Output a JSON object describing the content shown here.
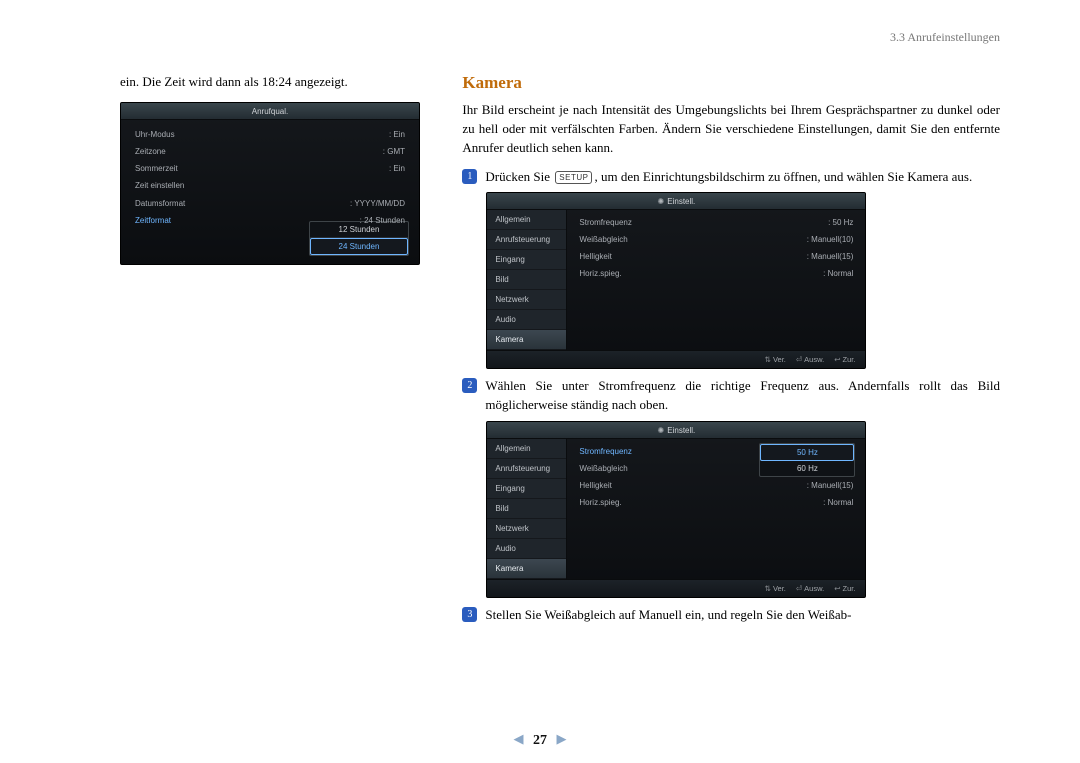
{
  "header": {
    "section_label": "3.3 Anrufeinstellungen"
  },
  "left": {
    "intro": "ein. Die Zeit wird dann als 18:24 angezeigt.",
    "shot1": {
      "title": "Anrufqual.",
      "rows": [
        {
          "k": "Uhr-Modus",
          "v": ": Ein"
        },
        {
          "k": "Zeitzone",
          "v": ": GMT"
        },
        {
          "k": "Sommerzeit",
          "v": ": Ein"
        },
        {
          "k": "Zeit einstellen",
          "v": ""
        },
        {
          "k": "Datumsformat",
          "v": ": YYYY/MM/DD"
        }
      ],
      "active_row": {
        "k": "Zeitformat",
        "v": ": 24 Stunden"
      },
      "options": [
        {
          "label": "12 Stunden",
          "sel": false
        },
        {
          "label": "24 Stunden",
          "sel": true
        }
      ]
    }
  },
  "right": {
    "title": "Kamera",
    "intro": "Ihr Bild erscheint je nach Intensität des Umgebungslichts bei Ihrem Gesprächspartner zu dunkel oder zu hell oder mit verfälschten Farben. Ändern Sie verschiedene Einstellungen, damit Sie den entfernte Anrufer deutlich sehen kann.",
    "steps": {
      "s1a": "Drücken Sie ",
      "s1_key": "SETUP",
      "s1b": ", um den Einrichtungsbildschirm zu öffnen, und wählen Sie Kamera aus.",
      "s2": "Wählen Sie unter Stromfrequenz die richtige Frequenz aus. Andernfalls rollt das Bild möglicherweise ständig nach oben.",
      "s3": "Stellen Sie Weißabgleich auf Manuell ein, und regeln Sie den Weißab-"
    },
    "shot2": {
      "title": "Einstell.",
      "sidebar": [
        "Allgemein",
        "Anrufsteuerung",
        "Eingang",
        "Bild",
        "Netzwerk",
        "Audio",
        "Kamera"
      ],
      "sidebar_sel": 6,
      "rows": [
        {
          "k": "Stromfrequenz",
          "v": ": 50 Hz"
        },
        {
          "k": "Weißabgleich",
          "v": ": Manuell(10)"
        },
        {
          "k": "Helligkeit",
          "v": ": Manuell(15)"
        },
        {
          "k": "Horiz.spieg.",
          "v": ": Normal"
        }
      ],
      "foot": {
        "ver": "Ver.",
        "ausw": "Ausw.",
        "zur": "Zur."
      }
    },
    "shot3": {
      "title": "Einstell.",
      "sidebar": [
        "Allgemein",
        "Anrufsteuerung",
        "Eingang",
        "Bild",
        "Netzwerk",
        "Audio",
        "Kamera"
      ],
      "sidebar_sel": 6,
      "rows": [
        {
          "k": "Stromfrequenz",
          "v": ""
        },
        {
          "k": "Weißabgleich",
          "v": ""
        },
        {
          "k": "Helligkeit",
          "v": ": Manuell(15)"
        },
        {
          "k": "Horiz.spieg.",
          "v": ": Normal"
        }
      ],
      "options": [
        {
          "label": "50 Hz",
          "sel": true
        },
        {
          "label": "60 Hz",
          "sel": false
        }
      ],
      "foot": {
        "ver": "Ver.",
        "ausw": "Ausw.",
        "zur": "Zur."
      }
    }
  },
  "pager": {
    "page": "27"
  }
}
